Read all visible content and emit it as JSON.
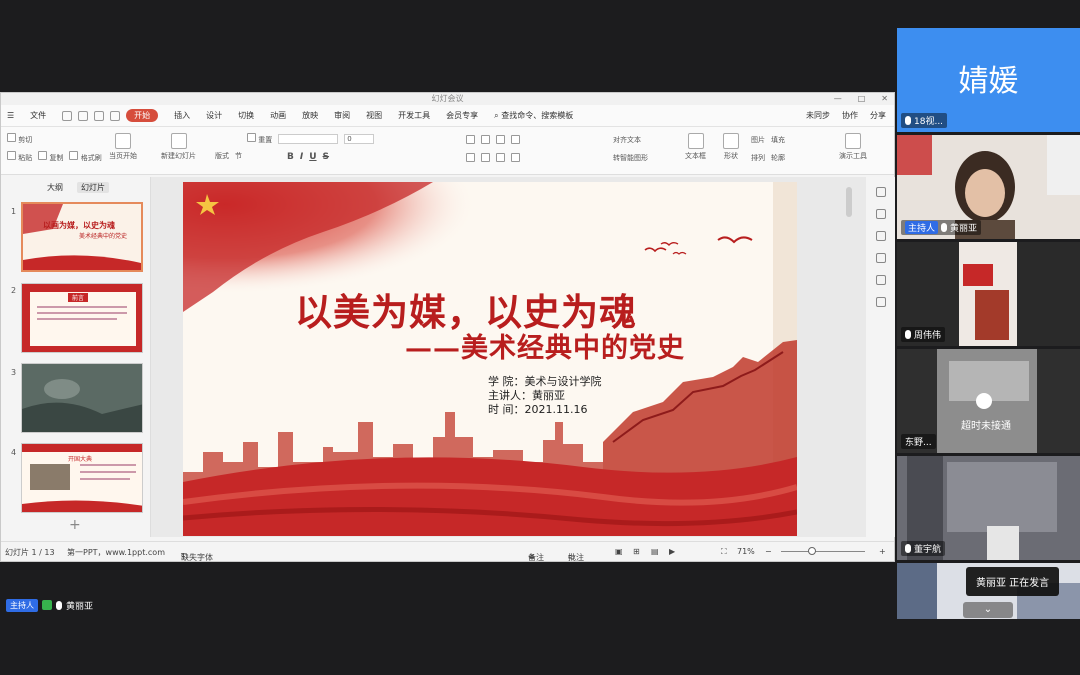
{
  "window": {
    "title": "幻灯会议"
  },
  "menubar": {
    "file_label": "文件",
    "tabs": [
      "开始",
      "插入",
      "设计",
      "切换",
      "动画",
      "放映",
      "审阅",
      "视图",
      "开发工具",
      "会员专享"
    ],
    "active_tab": "开始",
    "search_label": "查找命令、搜索模板",
    "right_items": [
      "未同步",
      "协作",
      "分享"
    ]
  },
  "ribbon": {
    "cut": "剪切",
    "copy": "复制",
    "paste": "粘贴",
    "format_painter": "格式刷",
    "from_current": "当页开始",
    "new_slide": "新建幻灯片",
    "layout": "版式",
    "section": "节",
    "reset": "重置",
    "font_size": "0",
    "text_box": "文本框",
    "shape": "形状",
    "picture": "图片",
    "arrange": "排列",
    "fill": "填充",
    "outline": "轮廓",
    "presenter_tools": "演示工具",
    "align_text": "对齐文本",
    "convert_smartart": "转智能图形"
  },
  "thumbnails": {
    "tabs": [
      "大纲",
      "幻灯片"
    ],
    "active_tab": "幻灯片",
    "items": [
      {
        "num": "1",
        "title": "以画为媒，以史为魂",
        "sub": "美术经典中的党史"
      },
      {
        "num": "2",
        "title": "前言",
        "sub": ""
      },
      {
        "num": "3",
        "title": "",
        "sub": ""
      },
      {
        "num": "4",
        "title": "开国大典",
        "sub": ""
      }
    ],
    "add_icon": "plus-icon"
  },
  "slide": {
    "title": "以美为媒，以史为魂",
    "subtitle": "——美术经典中的党史",
    "info": [
      "学    院：美术与设计学院",
      "主讲人：黄丽亚",
      "时    间：2021.11.16"
    ]
  },
  "statusbar": {
    "slide_counter": "幻灯片 1 / 13",
    "theme": "第一PPT，www.1ppt.com",
    "missing_font": "缺失字体",
    "notes": "备注",
    "comments": "批注",
    "zoom": "71%"
  },
  "meeting_bottom": {
    "host_badge": "主持人",
    "host_name": "黄丽亚"
  },
  "participants": [
    {
      "name": "18视...",
      "big_name": "婧媛",
      "bg": "#3d8ef0",
      "host": false
    },
    {
      "name": "黄丽亚",
      "bg": "#7a6a5a",
      "host": true,
      "host_badge": "主持人"
    },
    {
      "name": "周伟伟",
      "bg": "#2a2a2a",
      "host": false
    },
    {
      "name": "东野...",
      "bg": "#3a3a3a",
      "host": false,
      "overlay": "超时未接通"
    },
    {
      "name": "董宇航",
      "bg": "#5a5a62",
      "host": false
    },
    {
      "name": "",
      "bg": "#44506a",
      "host": false
    }
  ],
  "speaking_toast": "黄丽亚  正在发言",
  "colors": {
    "accent_red": "#b81e1e",
    "host_blue": "#2f6ce5",
    "wps_orange": "#d64d3c"
  }
}
